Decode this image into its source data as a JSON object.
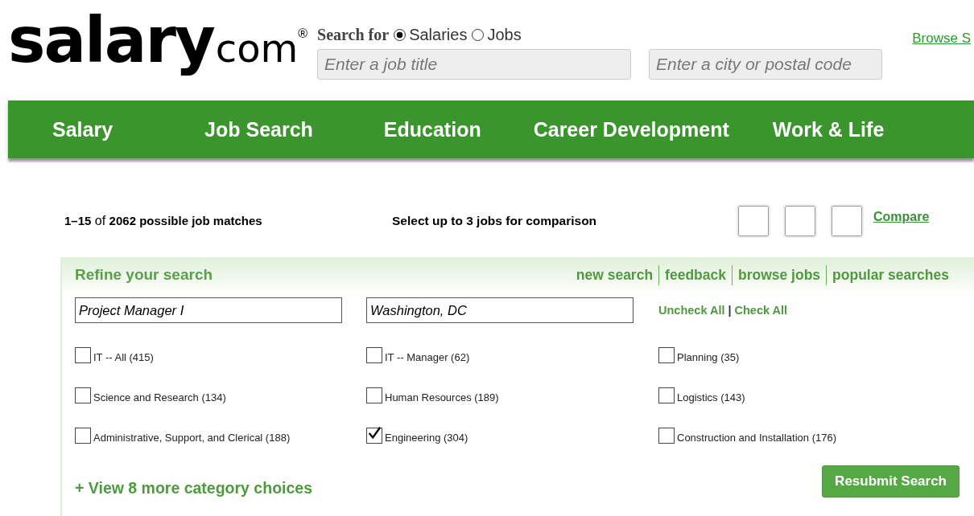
{
  "logo": {
    "word": "salary",
    "suffix": "com",
    "mark": "®"
  },
  "search": {
    "label": "Search for",
    "options": [
      {
        "label": "Salaries",
        "selected": true
      },
      {
        "label": "Jobs",
        "selected": false
      }
    ],
    "job_placeholder": "Enter a job title",
    "location_placeholder": "Enter a city or postal code",
    "browse_link": "Browse S"
  },
  "nav": [
    "Salary",
    "Job Search",
    "Education",
    "Career Development",
    "Work & Life"
  ],
  "results": {
    "summary": "**1–15** of **2062 possible job matches**",
    "compare_hint": "Select up to 3 jobs for comparison",
    "compare_slots": [
      {
        "filled": false
      },
      {
        "filled": false
      },
      {
        "filled": false
      }
    ],
    "compare_link": "Compare"
  },
  "refine": {
    "title": "Refine your search",
    "links": [
      "new search",
      "feedback",
      "browse jobs",
      "popular searches"
    ],
    "job_value": "Project Manager I",
    "location_value": "Washington, DC",
    "uncheck_all": "Uncheck All",
    "separator": "|",
    "check_all": "Check All",
    "categories": [
      {
        "label": "IT -- All (415)",
        "checked": false
      },
      {
        "label": "IT -- Manager (62)",
        "checked": false
      },
      {
        "label": "Planning (35)",
        "checked": false
      },
      {
        "label": "Science and Research (134)",
        "checked": false
      },
      {
        "label": "Human Resources (189)",
        "checked": false
      },
      {
        "label": "Logistics (143)",
        "checked": false
      },
      {
        "label": "Administrative, Support, and Clerical (188)",
        "checked": false
      },
      {
        "label": "Engineering (304)",
        "checked": true
      },
      {
        "label": "Construction and Installation (176)",
        "checked": false
      }
    ],
    "more_link": "+ View 8 more category choices",
    "resubmit": "Resubmit Search"
  }
}
